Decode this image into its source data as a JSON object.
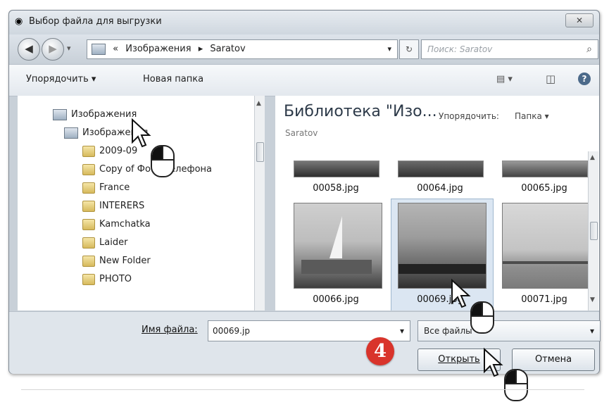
{
  "window": {
    "title": "Выбор файла для выгрузки",
    "close_glyph": "✕"
  },
  "nav": {
    "back_glyph": "◀",
    "forward_glyph": "▶",
    "address_prefix": "«",
    "breadcrumb": [
      "Изображения",
      "Saratov"
    ],
    "breadcrumb_sep": "▸",
    "refresh_glyph": "↻",
    "search_placeholder": "Поиск: Saratov",
    "search_icon": "⌕"
  },
  "toolbar": {
    "organize": "Упорядочить ▾",
    "new_folder": "Новая папка",
    "view_glyph": "▤ ▾",
    "pane_glyph": "◫",
    "help_glyph": "?"
  },
  "tree": {
    "items": [
      {
        "label": "Изображения",
        "type": "library"
      },
      {
        "label": "Изображения",
        "type": "library"
      },
      {
        "label": "2009-09",
        "type": "folder"
      },
      {
        "label": "Copy of Фото телефона",
        "type": "folder"
      },
      {
        "label": "France",
        "type": "folder"
      },
      {
        "label": "INTERERS",
        "type": "folder"
      },
      {
        "label": "Kamchatka",
        "type": "folder"
      },
      {
        "label": "Laider",
        "type": "folder"
      },
      {
        "label": "New Folder",
        "type": "folder"
      },
      {
        "label": "PHOTO",
        "type": "folder"
      }
    ]
  },
  "library": {
    "title": "Библиотека \"Изо...",
    "subtitle": "Saratov",
    "arrange_label": "Упорядочить:",
    "arrange_value": "Папка ▾"
  },
  "files": [
    {
      "name": "00058.jpg"
    },
    {
      "name": "00064.jpg"
    },
    {
      "name": "00065.jpg"
    },
    {
      "name": "00066.jpg"
    },
    {
      "name": "00069.jpg"
    },
    {
      "name": "00071.jpg"
    }
  ],
  "footer": {
    "filename_label": "Имя файла:",
    "filename_value": "00069.jp",
    "filetype_value": "Все файлы",
    "open_label": "Открыть",
    "cancel_label": "Отмена",
    "dropdown_glyph": "▾"
  },
  "annotation": {
    "step": "4"
  }
}
